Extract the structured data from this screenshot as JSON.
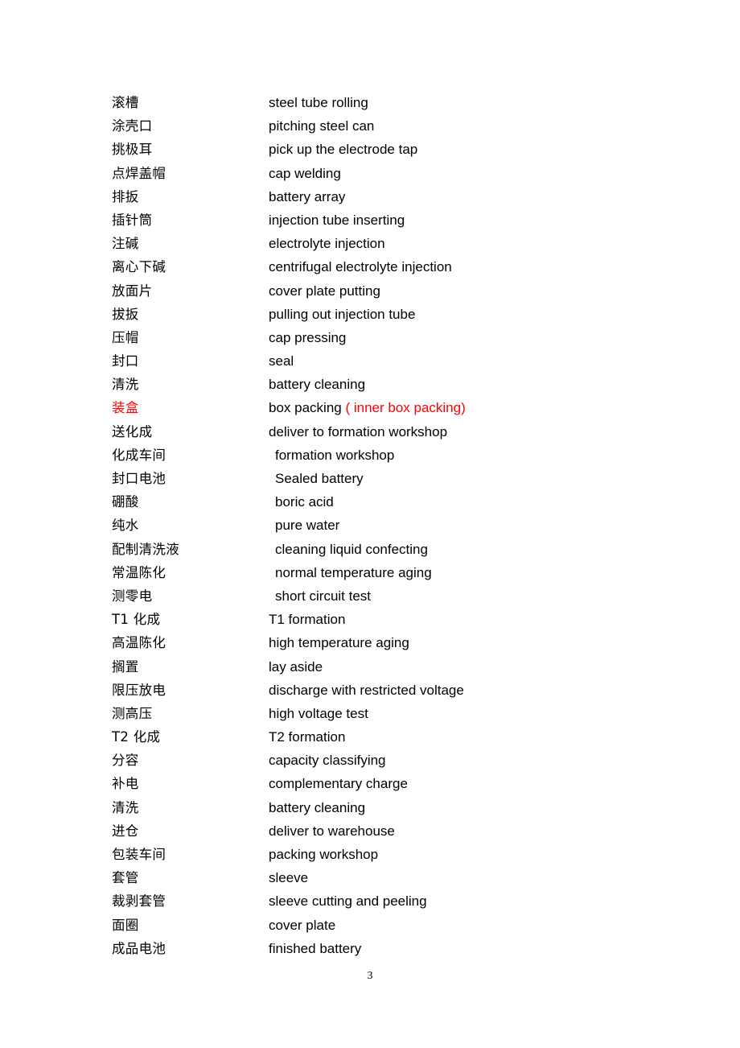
{
  "document": {
    "page_number": "3",
    "accent_color": "#ff0000",
    "text_color": "#000000",
    "background_color": "#ffffff"
  },
  "glossary": {
    "rows": [
      {
        "term": "滚槽",
        "gloss": "steel tube rolling",
        "indented": false,
        "highlight": false
      },
      {
        "term": "涂壳口",
        "gloss": "pitching steel can",
        "indented": false,
        "highlight": false
      },
      {
        "term": "挑极耳",
        "gloss": "pick up the electrode tap",
        "indented": false,
        "highlight": false
      },
      {
        "term": "点焊盖帽",
        "gloss": "cap welding",
        "indented": false,
        "highlight": false
      },
      {
        "term": "排扳",
        "gloss": "battery array",
        "indented": false,
        "highlight": false
      },
      {
        "term": "插针筒",
        "gloss": "injection tube inserting",
        "indented": false,
        "highlight": false
      },
      {
        "term": "注碱",
        "gloss": "electrolyte injection",
        "indented": false,
        "highlight": false
      },
      {
        "term": "离心下碱",
        "gloss": "centrifugal electrolyte injection",
        "indented": false,
        "highlight": false
      },
      {
        "term": "放面片",
        "gloss": "cover plate putting",
        "indented": false,
        "highlight": false
      },
      {
        "term": "拔扳",
        "gloss": "pulling out injection tube",
        "indented": false,
        "highlight": false
      },
      {
        "term": "压帽",
        "gloss": "cap pressing",
        "indented": false,
        "highlight": false
      },
      {
        "term": "封口",
        "gloss": "seal",
        "indented": false,
        "highlight": false
      },
      {
        "term": "清洗",
        "gloss": "battery cleaning",
        "indented": false,
        "highlight": false
      },
      {
        "term": "装盒",
        "gloss": "box packing ",
        "gloss_accent": "( inner box packing)",
        "indented": false,
        "highlight": true
      },
      {
        "term": "送化成",
        "gloss": "deliver to formation workshop",
        "indented": false,
        "highlight": false
      },
      {
        "term": "化成车间",
        "gloss": "formation workshop",
        "indented": true,
        "highlight": false
      },
      {
        "term": "封口电池",
        "gloss": "Sealed battery",
        "indented": true,
        "highlight": false
      },
      {
        "term": "硼酸",
        "gloss": "boric acid",
        "indented": true,
        "highlight": false
      },
      {
        "term": "纯水",
        "gloss": "pure water",
        "indented": true,
        "highlight": false
      },
      {
        "term": "配制清洗液",
        "gloss": "cleaning liquid confecting",
        "indented": true,
        "highlight": false
      },
      {
        "term": "常温陈化",
        "gloss": "normal temperature aging",
        "indented": true,
        "highlight": false
      },
      {
        "term": "测零电",
        "gloss": "short circuit test",
        "indented": true,
        "highlight": false
      },
      {
        "term": "T1 化成",
        "gloss": "T1 formation",
        "indented": false,
        "highlight": false
      },
      {
        "term": "高温陈化",
        "gloss": "high temperature aging",
        "indented": false,
        "highlight": false
      },
      {
        "term": "搁置",
        "gloss": "lay aside",
        "indented": false,
        "highlight": false
      },
      {
        "term": "限压放电",
        "gloss": "discharge with restricted voltage",
        "indented": false,
        "highlight": false
      },
      {
        "term": "测高压",
        "gloss": "high voltage test",
        "indented": false,
        "highlight": false
      },
      {
        "term": "T2 化成",
        "gloss": "T2 formation",
        "indented": false,
        "highlight": false
      },
      {
        "term": "分容",
        "gloss": "capacity classifying",
        "indented": false,
        "highlight": false
      },
      {
        "term": "补电",
        "gloss": "complementary charge",
        "indented": false,
        "highlight": false
      },
      {
        "term": "清洗",
        "gloss": "battery cleaning",
        "indented": false,
        "highlight": false
      },
      {
        "term": "进仓",
        "gloss": "deliver to warehouse",
        "indented": false,
        "highlight": false
      },
      {
        "term": "包装车间",
        "gloss": "packing workshop",
        "indented": false,
        "highlight": false
      },
      {
        "term": "套管",
        "gloss": "sleeve",
        "indented": false,
        "highlight": false
      },
      {
        "term": "裁剥套管",
        "gloss": "sleeve cutting and peeling",
        "indented": false,
        "highlight": false
      },
      {
        "term": "面圈",
        "gloss": "cover plate",
        "indented": false,
        "highlight": false
      },
      {
        "term": "成品电池",
        "gloss": "finished battery",
        "indented": false,
        "highlight": false
      }
    ]
  }
}
